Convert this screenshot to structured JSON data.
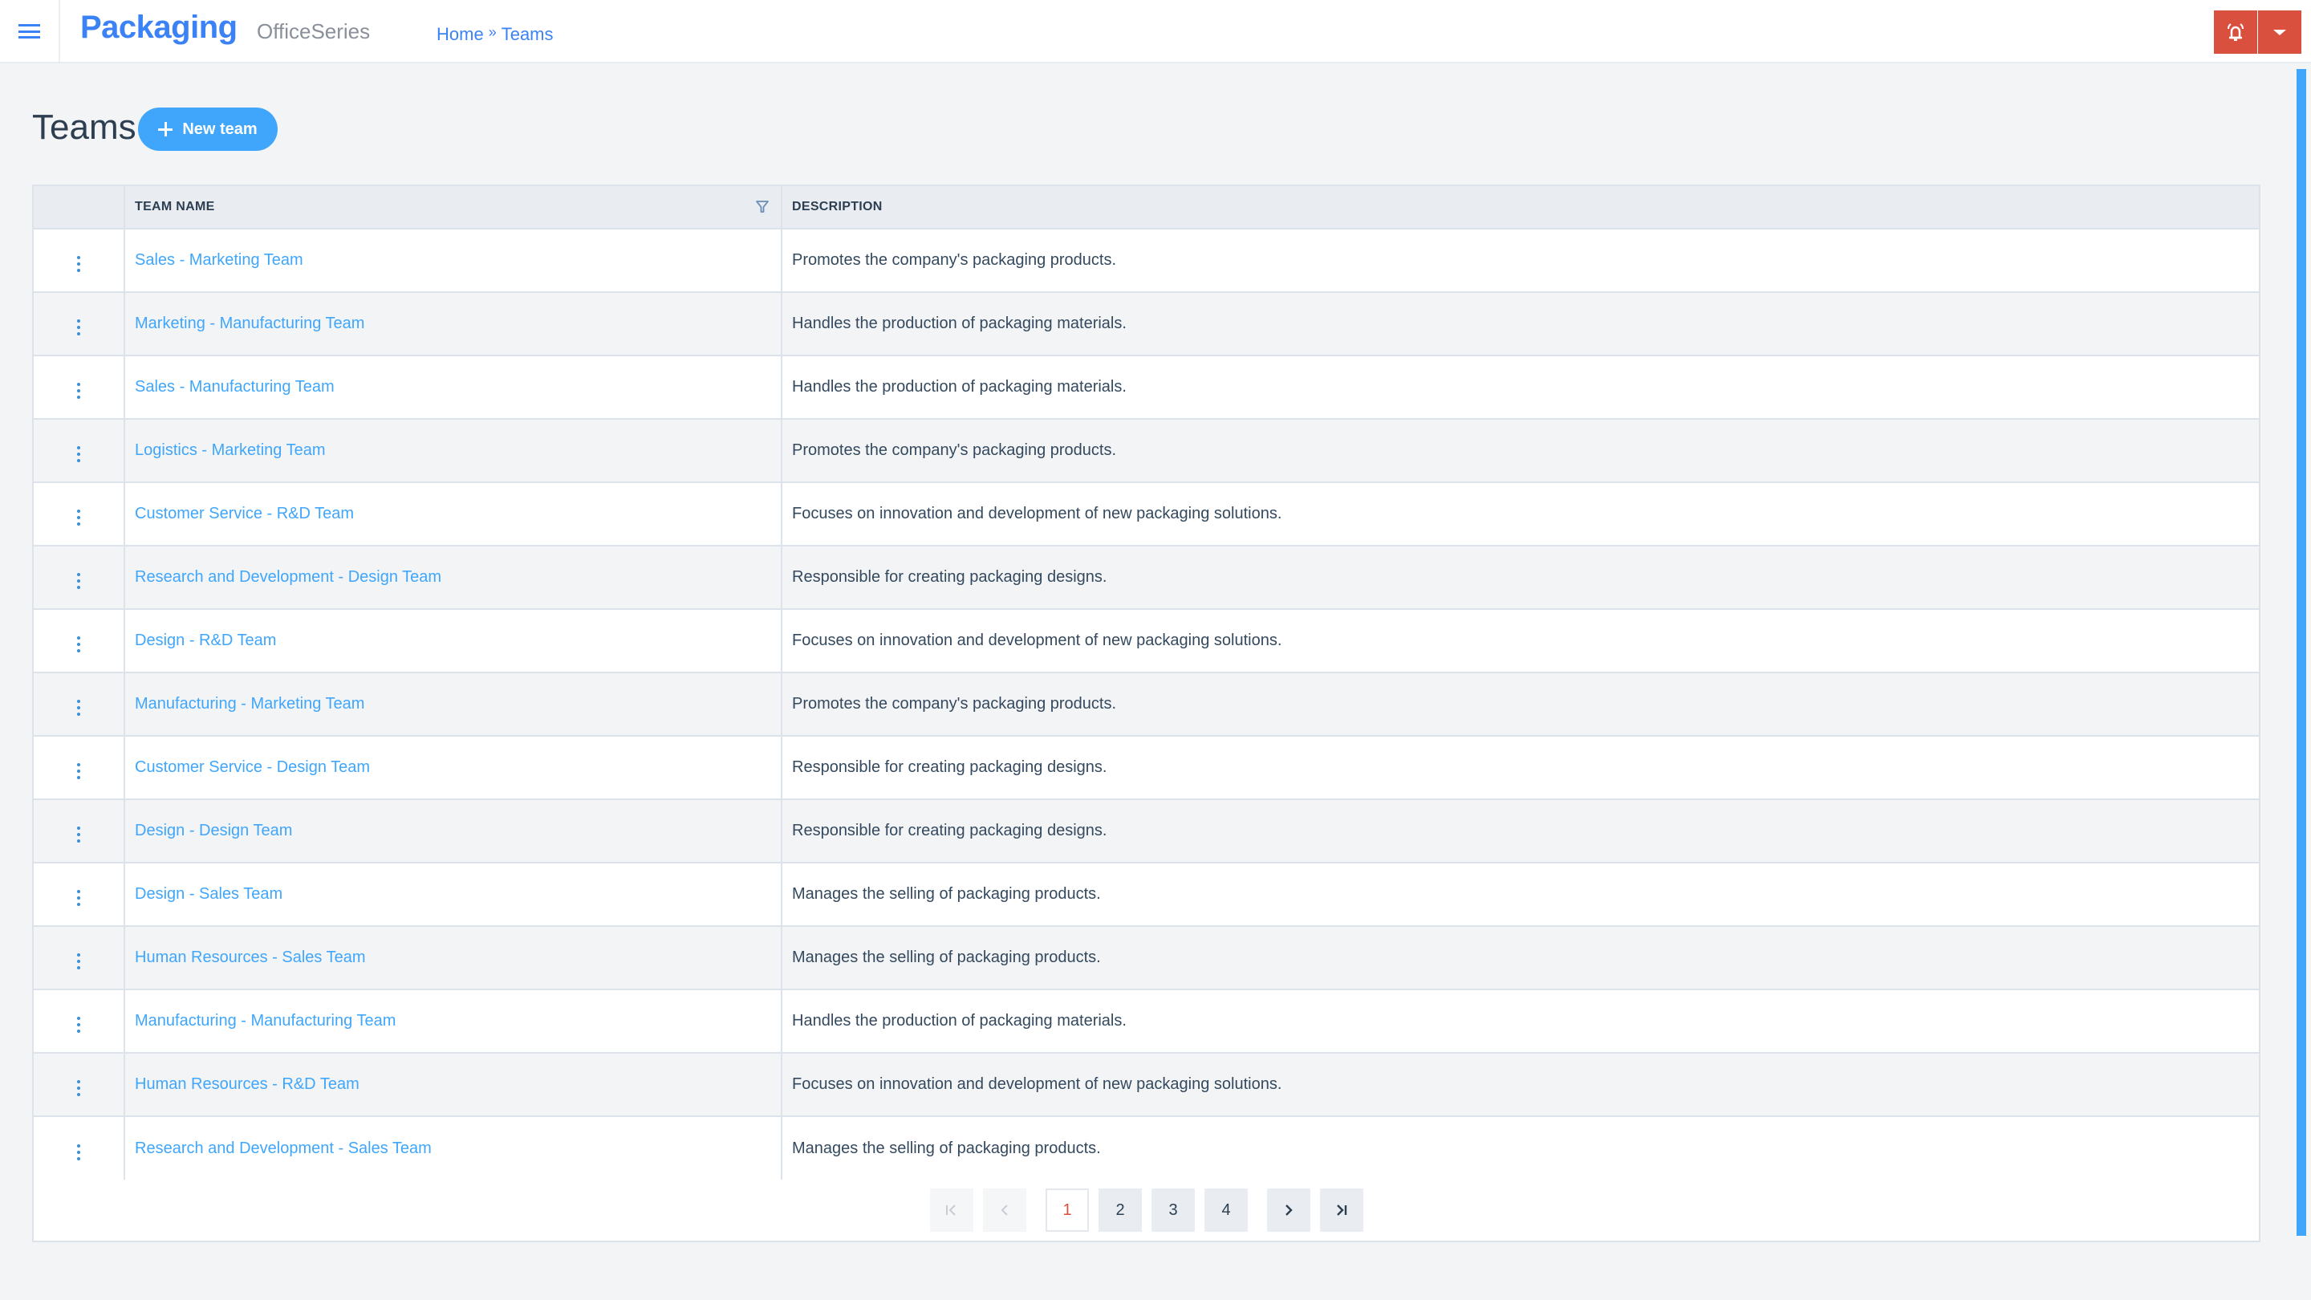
{
  "header": {
    "menu_icon": "hamburger-icon",
    "brand": "Packaging",
    "product": "OfficeSeries",
    "breadcrumb": [
      {
        "label": "Home"
      },
      {
        "label": "Teams"
      }
    ],
    "breadcrumb_separator": "»",
    "alert_icon": "bell-ringing-icon",
    "dropdown_icon": "caret-down-icon",
    "accent_color": "#3b82f6",
    "alert_color": "#d9503f"
  },
  "page": {
    "title": "Teams",
    "new_button_label": "New team",
    "new_button_color": "#3fa6fb"
  },
  "table": {
    "columns": [
      {
        "label": ""
      },
      {
        "label": "TEAM NAME",
        "filterable": true
      },
      {
        "label": "DESCRIPTION"
      }
    ],
    "rows": [
      {
        "name": "Sales - Marketing Team",
        "description": "Promotes the company's packaging products."
      },
      {
        "name": "Marketing - Manufacturing Team",
        "description": "Handles the production of packaging materials."
      },
      {
        "name": "Sales - Manufacturing Team",
        "description": "Handles the production of packaging materials."
      },
      {
        "name": "Logistics - Marketing Team",
        "description": "Promotes the company's packaging products."
      },
      {
        "name": "Customer Service - R&D Team",
        "description": "Focuses on innovation and development of new packaging solutions."
      },
      {
        "name": "Research and Development - Design Team",
        "description": "Responsible for creating packaging designs."
      },
      {
        "name": "Design - R&D Team",
        "description": "Focuses on innovation and development of new packaging solutions."
      },
      {
        "name": "Manufacturing - Marketing Team",
        "description": "Promotes the company's packaging products."
      },
      {
        "name": "Customer Service - Design Team",
        "description": "Responsible for creating packaging designs."
      },
      {
        "name": "Design - Design Team",
        "description": "Responsible for creating packaging designs."
      },
      {
        "name": "Design - Sales Team",
        "description": "Manages the selling of packaging products."
      },
      {
        "name": "Human Resources - Sales Team",
        "description": "Manages the selling of packaging products."
      },
      {
        "name": "Manufacturing - Manufacturing Team",
        "description": "Handles the production of packaging materials."
      },
      {
        "name": "Human Resources - R&D Team",
        "description": "Focuses on innovation and development of new packaging solutions."
      },
      {
        "name": "Research and Development - Sales Team",
        "description": "Manages the selling of packaging products."
      }
    ]
  },
  "pagination": {
    "first_label": "|<",
    "prev_label": "<",
    "pages": [
      "1",
      "2",
      "3",
      "4"
    ],
    "current_page": "1",
    "next_label": ">",
    "last_label": ">|"
  }
}
